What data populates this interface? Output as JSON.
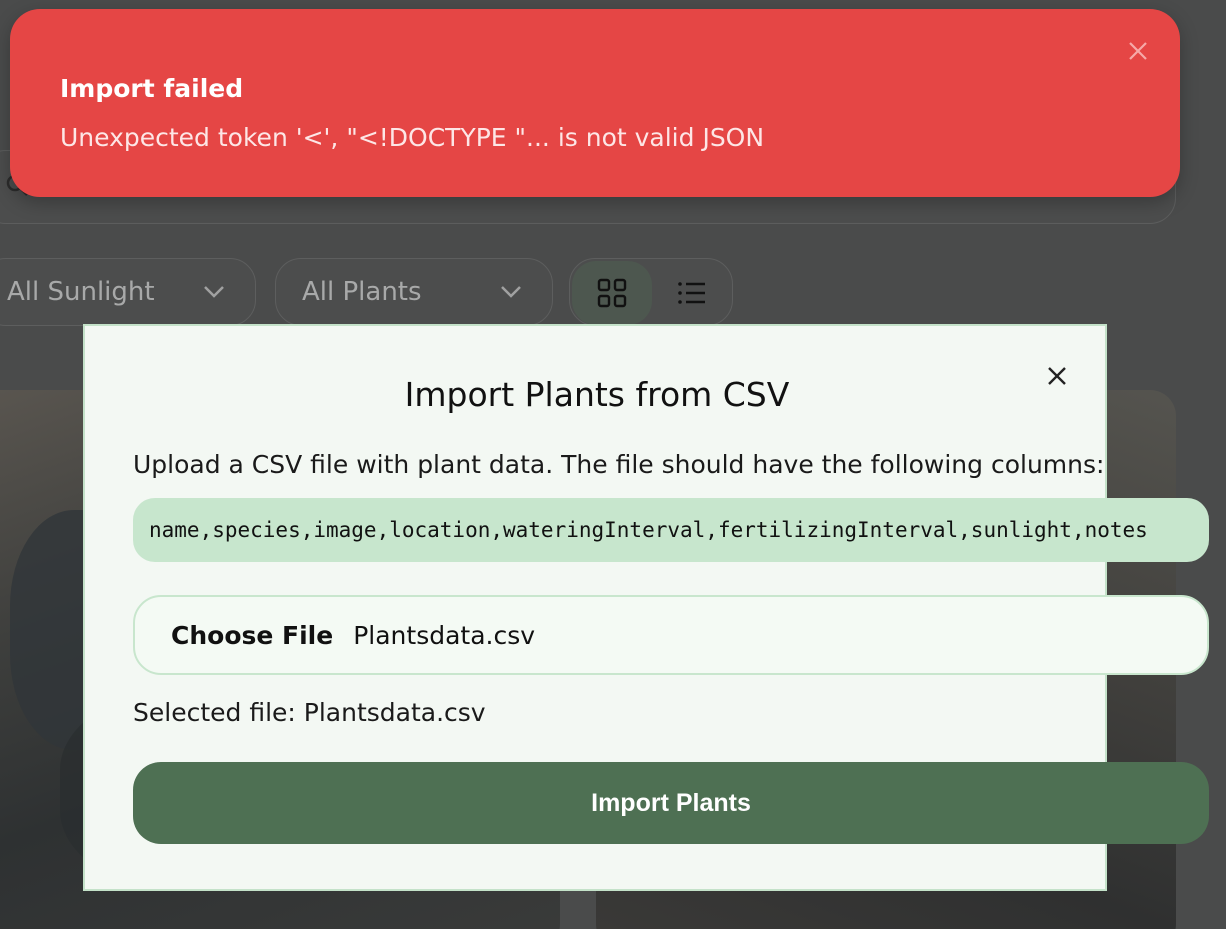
{
  "toast": {
    "title": "Import failed",
    "message": "Unexpected token '<', \"<!DOCTYPE \"... is not valid JSON",
    "close_icon": "close-icon",
    "color": "#e54645"
  },
  "background": {
    "filters": {
      "sunlight": "All Sunlight",
      "plants": "All Plants"
    },
    "view_toggle": {
      "grid_icon": "grid-icon",
      "list_icon": "list-icon"
    },
    "search_icon": "search-icon"
  },
  "modal": {
    "title": "Import Plants from CSV",
    "description": "Upload a CSV file with plant data. The file should have the following columns:",
    "columns": "name,species,image,location,wateringInterval,fertilizingInterval,sunlight,notes",
    "file_input": {
      "button_label": "Choose File",
      "file_name": "Plantsdata.csv"
    },
    "selected_file": "Selected file: Plantsdata.csv",
    "import_button": "Import Plants",
    "close_icon": "close-icon",
    "accent_color": "#4e7053"
  }
}
